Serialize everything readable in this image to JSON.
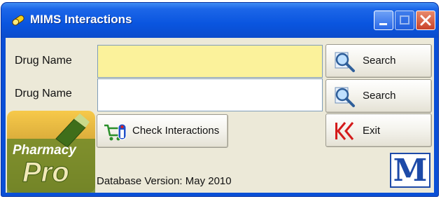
{
  "window": {
    "title": "MIMS Interactions",
    "icon": "pill-capsule-icon"
  },
  "form": {
    "drug1_label": "Drug Name",
    "drug1_value": "",
    "drug2_label": "Drug Name",
    "drug2_value": ""
  },
  "buttons": {
    "search1_label": "Search",
    "search2_label": "Search",
    "check_label": "Check Interactions",
    "exit_label": "Exit"
  },
  "footer": {
    "database_version": "Database Version: May 2010",
    "logo_left_line1": "Pharmacy",
    "logo_left_line2": "Pro",
    "logo_right_letter": "M"
  },
  "colors": {
    "titlebar": "#0a55df",
    "client_bg": "#ece9d8",
    "field_highlight": "#fbf29b",
    "logo_m": "#1d4aa8"
  }
}
